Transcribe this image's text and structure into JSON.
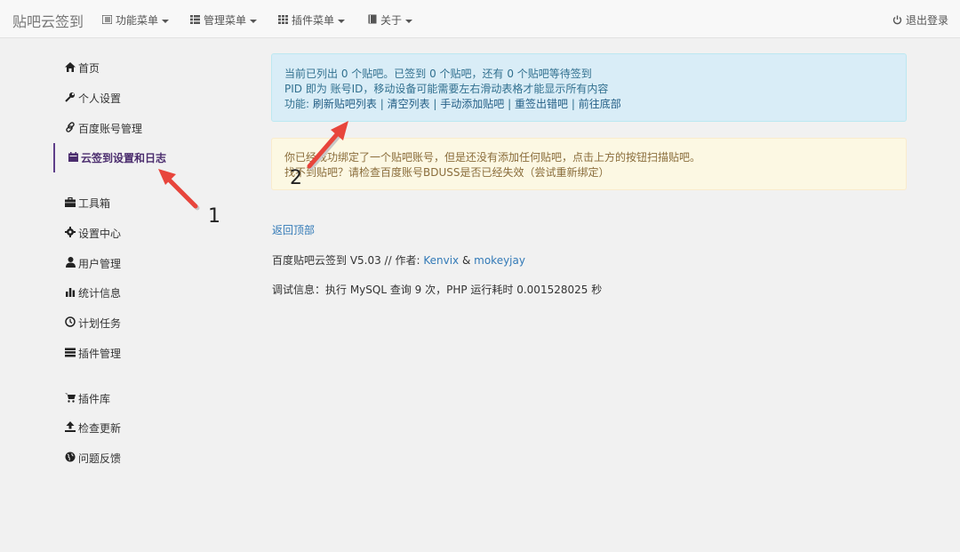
{
  "navbar": {
    "brand": "贴吧云签到",
    "menus": [
      {
        "label": "功能菜单",
        "icon": "list-icon"
      },
      {
        "label": "管理菜单",
        "icon": "table-icon"
      },
      {
        "label": "插件菜单",
        "icon": "grid-icon"
      },
      {
        "label": "关于",
        "icon": "book-icon"
      }
    ],
    "logout": "退出登录"
  },
  "sidebar": {
    "items": [
      {
        "label": "首页",
        "icon": "home-icon"
      },
      {
        "label": "个人设置",
        "icon": "wrench-icon"
      },
      {
        "label": "百度账号管理",
        "icon": "link-icon"
      },
      {
        "label": "云签到设置和日志",
        "icon": "calendar-icon",
        "active": true
      },
      {
        "label": "工具箱",
        "icon": "briefcase-icon"
      },
      {
        "label": "设置中心",
        "icon": "cog-icon"
      },
      {
        "label": "用户管理",
        "icon": "user-icon"
      },
      {
        "label": "统计信息",
        "icon": "stats-icon"
      },
      {
        "label": "计划任务",
        "icon": "clock-icon"
      },
      {
        "label": "插件管理",
        "icon": "hdd-icon"
      },
      {
        "label": "插件库",
        "icon": "cart-icon"
      },
      {
        "label": "检查更新",
        "icon": "upload-icon"
      },
      {
        "label": "问题反馈",
        "icon": "globe-icon"
      }
    ]
  },
  "info_alert": {
    "line1": "当前已列出 0 个贴吧。已签到 0 个贴吧，还有 0 个贴吧等待签到",
    "line2": "PID 即为 账号ID，移动设备可能需要左右滑动表格才能显示所有内容",
    "func_prefix": "功能: ",
    "links": [
      "刷新贴吧列表",
      "清空列表",
      "手动添加贴吧",
      "重签出错吧",
      "前往底部"
    ],
    "separator": "|"
  },
  "warning_alert": {
    "line1": "你已经成功绑定了一个贴吧账号，但是还没有添加任何贴吧，点击上方的按钮扫描贴吧。",
    "line2": "找不到贴吧？请检查百度账号BDUSS是否已经失效（尝试重新绑定）"
  },
  "footer": {
    "back_to_top": "返回顶部",
    "version_prefix": "百度贴吧云签到 V5.03 // 作者: ",
    "author1": "Kenvix",
    "amp": "&",
    "author2": "mokeyjay",
    "debug": "调试信息：执行 MySQL 查询 9 次，PHP 运行耗时 0.001528025 秒"
  },
  "annotations": {
    "arrow1_label": "1",
    "arrow2_label": "2",
    "arrow_color": "#e8453c"
  }
}
